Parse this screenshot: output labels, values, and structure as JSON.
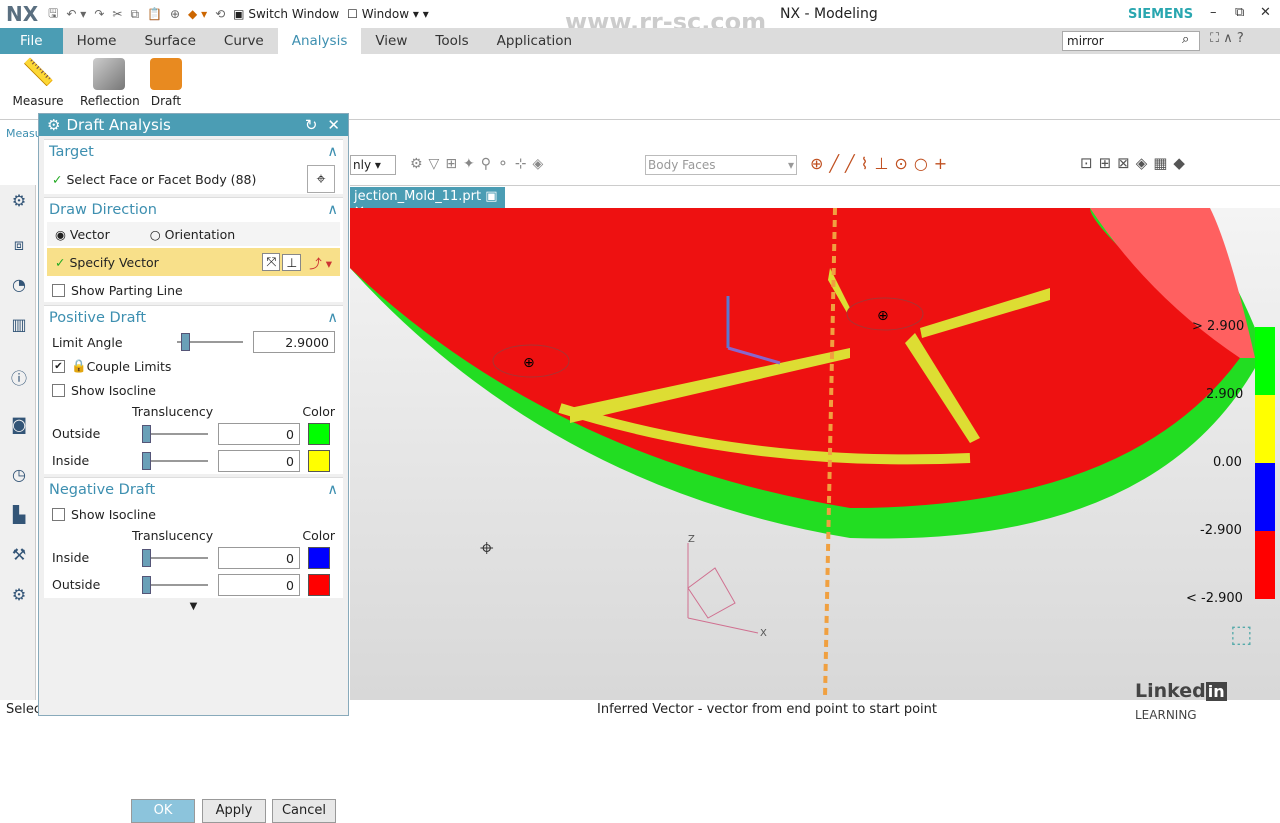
{
  "app": {
    "logo": "NX",
    "title": "NX - Modeling",
    "brand": "SIEMENS",
    "watermark": "www.rr-sc.com"
  },
  "quick_access": {
    "switch_window": "Switch Window",
    "window": "Window"
  },
  "tabs": [
    {
      "label": "File"
    },
    {
      "label": "Home"
    },
    {
      "label": "Surface"
    },
    {
      "label": "Curve"
    },
    {
      "label": "Analysis",
      "active": true
    },
    {
      "label": "View"
    },
    {
      "label": "Tools"
    },
    {
      "label": "Application"
    }
  ],
  "search": {
    "value": "mirror"
  },
  "ribbon": {
    "buttons": [
      {
        "label": "Measure"
      },
      {
        "label": "Reflection"
      },
      {
        "label": "Draft"
      }
    ],
    "group_label": "Measu"
  },
  "toolbar": {
    "filter_value": "nly",
    "selection_value": "Body Faces"
  },
  "file_tab": {
    "label": "jection_Mold_11.prt"
  },
  "dialog": {
    "title": "Draft Analysis",
    "target": {
      "header": "Target",
      "select_label": "Select Face or Facet Body (88)"
    },
    "draw_direction": {
      "header": "Draw Direction",
      "vector": "Vector",
      "orientation": "Orientation",
      "specify_vector": "Specify Vector",
      "show_parting_line": "Show Parting Line"
    },
    "positive_draft": {
      "header": "Positive Draft",
      "limit_angle_label": "Limit Angle",
      "limit_angle": "2.9000",
      "couple_limits": "Couple Limits",
      "couple_checked": true,
      "show_isocline": "Show Isocline",
      "translucency": "Translucency",
      "color": "Color",
      "outside": {
        "label": "Outside",
        "value": "0",
        "color": "#00ff00"
      },
      "inside": {
        "label": "Inside",
        "value": "0",
        "color": "#ffff00"
      }
    },
    "negative_draft": {
      "header": "Negative Draft",
      "show_isocline": "Show Isocline",
      "translucency": "Translucency",
      "color": "Color",
      "inside": {
        "label": "Inside",
        "value": "0",
        "color": "#0000ff"
      },
      "outside": {
        "label": "Outside",
        "value": "0",
        "color": "#ff0000"
      }
    },
    "ok": "OK",
    "apply": "Apply",
    "cancel": "Cancel"
  },
  "legend": {
    "labels": [
      "> 2.900",
      "2.900",
      "0.00",
      "-2.900",
      "< -2.900"
    ],
    "colors": [
      "#00ff00",
      "#ffff00",
      "#0000ff",
      "#ff0000"
    ]
  },
  "triad": {
    "z": "Z",
    "x": "X"
  },
  "status": {
    "left": "Selec",
    "message": "Inferred Vector - vector from end point to start point",
    "linkedin": "Linked",
    "learning": "LEARNING"
  }
}
